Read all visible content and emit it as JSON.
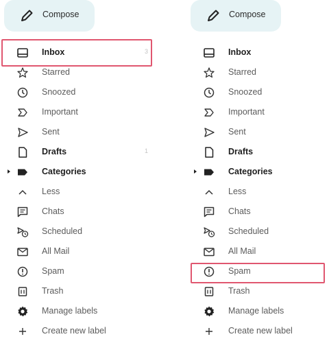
{
  "left_panel": {
    "compose_label": "Compose",
    "items": [
      {
        "label": "Inbox",
        "icon": "inbox-icon",
        "bold": true,
        "count": "3"
      },
      {
        "label": "Starred",
        "icon": "star-icon"
      },
      {
        "label": "Snoozed",
        "icon": "clock-icon"
      },
      {
        "label": "Important",
        "icon": "important-icon"
      },
      {
        "label": "Sent",
        "icon": "send-icon"
      },
      {
        "label": "Drafts",
        "icon": "draft-icon",
        "bold": true,
        "count": "1"
      },
      {
        "label": "Categories",
        "icon": "label-icon",
        "bold": true
      },
      {
        "label": "Less",
        "icon": "chevron-up-icon"
      },
      {
        "label": "Chats",
        "icon": "chat-icon"
      },
      {
        "label": "Scheduled",
        "icon": "scheduled-icon"
      },
      {
        "label": "All Mail",
        "icon": "mail-icon"
      },
      {
        "label": "Spam",
        "icon": "spam-icon"
      },
      {
        "label": "Trash",
        "icon": "trash-icon"
      },
      {
        "label": "Manage labels",
        "icon": "gear-icon"
      },
      {
        "label": "Create new label",
        "icon": "plus-icon"
      }
    ],
    "highlighted_item": "Inbox"
  },
  "right_panel": {
    "compose_label": "Compose",
    "items": [
      {
        "label": "Inbox",
        "icon": "inbox-icon",
        "bold": true
      },
      {
        "label": "Starred",
        "icon": "star-icon"
      },
      {
        "label": "Snoozed",
        "icon": "clock-icon"
      },
      {
        "label": "Important",
        "icon": "important-icon"
      },
      {
        "label": "Sent",
        "icon": "send-icon"
      },
      {
        "label": "Drafts",
        "icon": "draft-icon",
        "bold": true
      },
      {
        "label": "Categories",
        "icon": "label-icon",
        "bold": true
      },
      {
        "label": "Less",
        "icon": "chevron-up-icon"
      },
      {
        "label": "Chats",
        "icon": "chat-icon"
      },
      {
        "label": "Scheduled",
        "icon": "scheduled-icon"
      },
      {
        "label": "All Mail",
        "icon": "mail-icon"
      },
      {
        "label": "Spam",
        "icon": "spam-icon"
      },
      {
        "label": "Trash",
        "icon": "trash-icon"
      },
      {
        "label": "Manage labels",
        "icon": "gear-icon"
      },
      {
        "label": "Create new label",
        "icon": "plus-icon"
      }
    ],
    "highlighted_item": "Spam"
  },
  "colors": {
    "compose_bg": "#e6f3f5",
    "highlight": "#e0566f",
    "text": "#5b5b5b",
    "text_bold": "#1e1e1e"
  }
}
